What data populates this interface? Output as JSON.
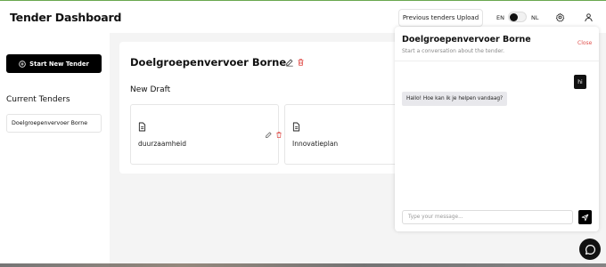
{
  "header": {
    "title": "Tender Dashboard",
    "previous_upload_label": "Previous tenders Upload",
    "lang_left": "EN",
    "lang_right": "NL",
    "icons": [
      "settings-icon",
      "user-icon"
    ]
  },
  "sidebar": {
    "start_button_label": "Start New Tender",
    "current_tenders_label": "Current Tenders",
    "tenders": [
      {
        "name": "Doelgroepenvervoer Borne"
      }
    ]
  },
  "main": {
    "tender_title": "Doelgroepenvervoer Borne",
    "section_label": "New Draft",
    "drafts": [
      {
        "name": "duurzaamheid"
      },
      {
        "name": "Innovatieplan"
      }
    ]
  },
  "chat": {
    "title": "Doelgroepenvervoer Borne",
    "subtitle": "Start a conversation about the tender.",
    "close_label": "Close",
    "messages": [
      {
        "from": "user",
        "text": "hi"
      },
      {
        "from": "bot",
        "text": "Hallo! Hoe kan ik je helpen vandaag?"
      }
    ],
    "input_placeholder": "Type your message..."
  },
  "colors": {
    "accent_dark": "#000000",
    "delete_red": "#e0524e",
    "main_bg": "#f4f4f4"
  }
}
